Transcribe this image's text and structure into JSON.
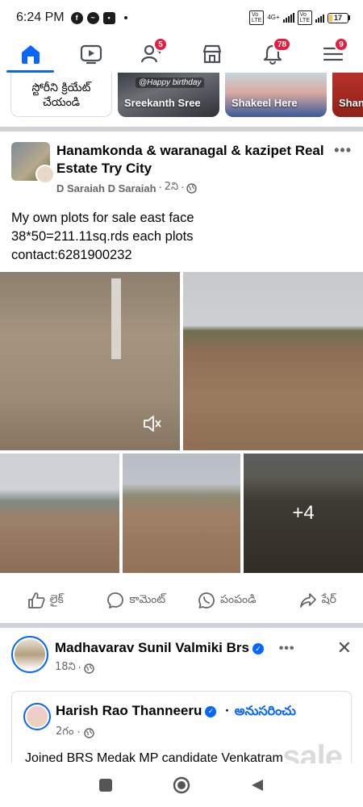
{
  "status_bar": {
    "time": "6:24 PM",
    "battery": "17",
    "battery_level": 0.17,
    "net": "4G+"
  },
  "nav": {
    "items": [
      {
        "name": "home",
        "icon": "home-icon",
        "badge": ""
      },
      {
        "name": "video",
        "icon": "video-icon",
        "badge": ""
      },
      {
        "name": "friends",
        "icon": "friends-icon",
        "badge": "5"
      },
      {
        "name": "marketplace",
        "icon": "marketplace-icon",
        "badge": ""
      },
      {
        "name": "notifications",
        "icon": "bell-icon",
        "badge": "78"
      },
      {
        "name": "menu",
        "icon": "menu-icon",
        "badge": "9"
      }
    ]
  },
  "stories": {
    "create_label": "స్టోరీని క్రియేట్\nచేయండి",
    "items": [
      {
        "name": "Sreekanth Sree",
        "tag": "@Happy birthday"
      },
      {
        "name": "Shakeel Here",
        "tag": ""
      },
      {
        "name": "Shan",
        "tag": ""
      }
    ]
  },
  "post1": {
    "page_name": "Hanamkonda & waranagal & kazipet Real Estate Try City",
    "author": "D Saraiah D Saraiah",
    "time": "2ని",
    "text": "My own plots for sale east face\n38*50=211.11sq.rds each plots\ncontact:6281900232",
    "more_photos": "+4",
    "actions": {
      "like": "లైక్",
      "comment": "కామెంట్",
      "send": "పంపండి",
      "share": "షేర్"
    }
  },
  "post2": {
    "author": "Madhavarav Sunil Valmiki Brs",
    "time": "18ని",
    "shared": {
      "author": "Harish Rao Thanneeru",
      "follow": "అనుసరించు",
      "time": "2గం",
      "text": "Joined BRS Medak MP candidate Venkatram"
    }
  },
  "watermark": "sale",
  "colors": {
    "accent": "#0866ff",
    "badge": "#e41e3f",
    "muted": "#65676b"
  }
}
